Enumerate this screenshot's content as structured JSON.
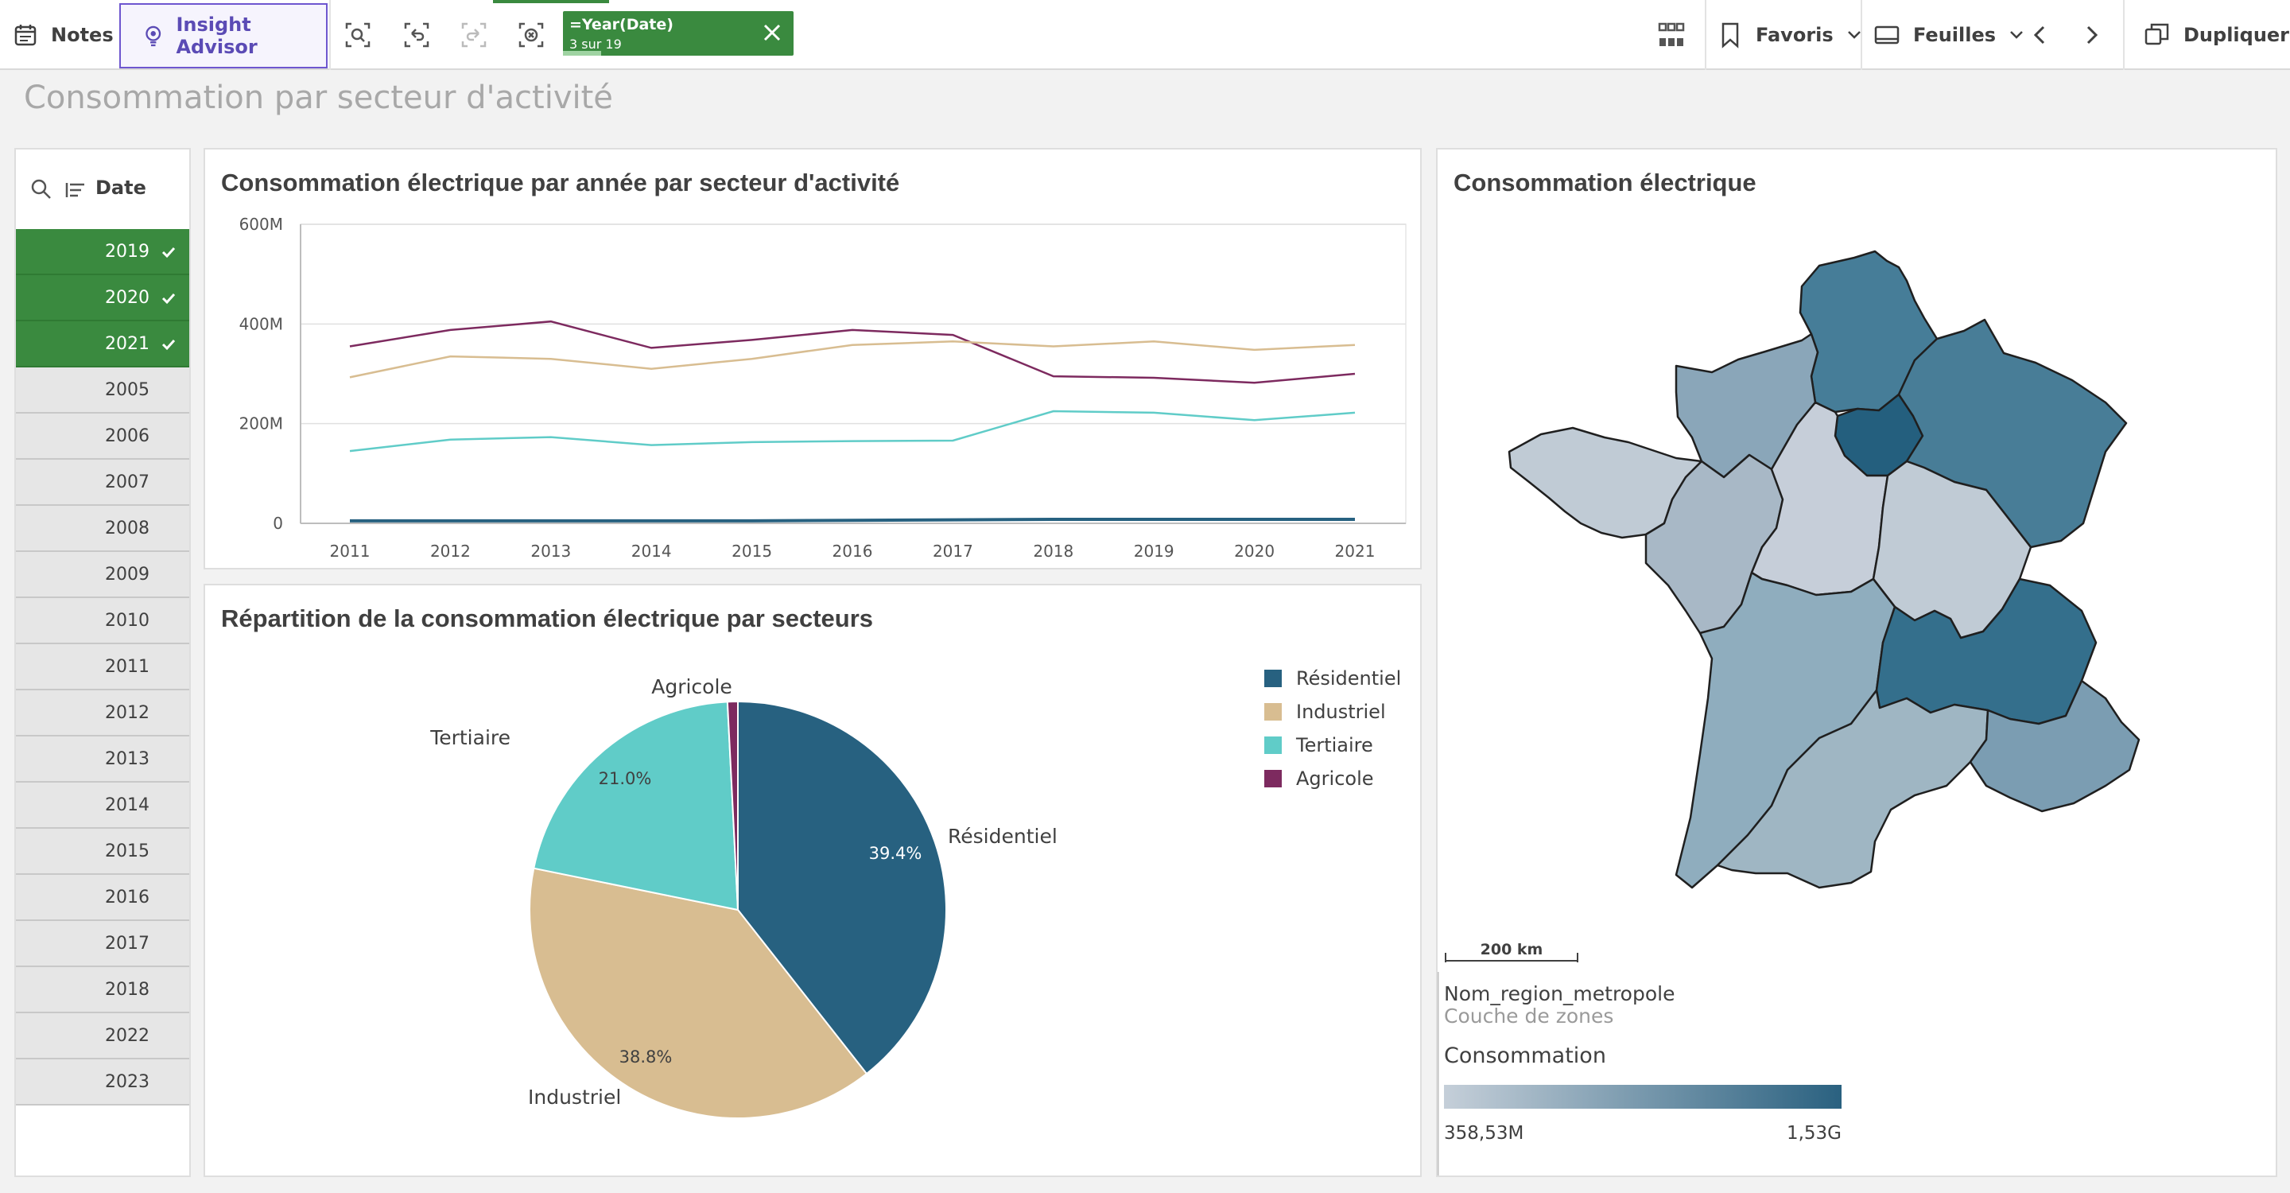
{
  "toolbar": {
    "notes_label": "Notes",
    "insight_label": "Insight Advisor",
    "selection": {
      "field": "=Year(Date)",
      "count": "3 sur 19"
    },
    "favoris_label": "Favoris",
    "feuilles_label": "Feuilles",
    "dupliquer_label": "Dupliquer"
  },
  "sheet_title": "Consommation par secteur d'activité",
  "filter": {
    "label": "Date",
    "items": [
      {
        "label": "2019",
        "selected": true
      },
      {
        "label": "2020",
        "selected": true
      },
      {
        "label": "2021",
        "selected": true
      },
      {
        "label": "2005",
        "selected": false
      },
      {
        "label": "2006",
        "selected": false
      },
      {
        "label": "2007",
        "selected": false
      },
      {
        "label": "2008",
        "selected": false
      },
      {
        "label": "2009",
        "selected": false
      },
      {
        "label": "2010",
        "selected": false
      },
      {
        "label": "2011",
        "selected": false
      },
      {
        "label": "2012",
        "selected": false
      },
      {
        "label": "2013",
        "selected": false
      },
      {
        "label": "2014",
        "selected": false
      },
      {
        "label": "2015",
        "selected": false
      },
      {
        "label": "2016",
        "selected": false
      },
      {
        "label": "2017",
        "selected": false
      },
      {
        "label": "2018",
        "selected": false
      },
      {
        "label": "2022",
        "selected": false
      },
      {
        "label": "2023",
        "selected": false
      }
    ]
  },
  "line_panel": {
    "title": "Consommation électrique par année par secteur d'activité"
  },
  "pie_panel": {
    "title": "Répartition de la consommation électrique par secteurs"
  },
  "map_panel": {
    "title": "Consommation électrique",
    "scale_label": "200 km",
    "layer_name": "Nom_region_metropole",
    "layer_type": "Couche de zones",
    "legend_title": "Consommation",
    "legend_min": "358,53M",
    "legend_max": "1,53G",
    "legend_colors": [
      "#c5cfd9",
      "#2a6180"
    ]
  },
  "colors": {
    "accent_green": "#3a8a3f",
    "residentiel": "#276180",
    "industriel": "#d8bd91",
    "tertiaire": "#60ccc8",
    "agricole": "#7d2a5f"
  },
  "chart_data": [
    {
      "type": "line",
      "x": [
        "2011",
        "2012",
        "2013",
        "2014",
        "2015",
        "2016",
        "2017",
        "2018",
        "2019",
        "2020",
        "2021"
      ],
      "yticks": [
        "0",
        "200M",
        "400M",
        "600M"
      ],
      "ylim": [
        0,
        600
      ],
      "series": [
        {
          "color": "#7d2a5f",
          "values": [
            355,
            388,
            405,
            352,
            368,
            388,
            378,
            295,
            292,
            282,
            300
          ]
        },
        {
          "color": "#d8bd91",
          "values": [
            293,
            335,
            330,
            310,
            330,
            358,
            365,
            355,
            365,
            348,
            358
          ]
        },
        {
          "color": "#60ccc8",
          "values": [
            145,
            168,
            173,
            157,
            163,
            165,
            166,
            225,
            222,
            207,
            222
          ]
        },
        {
          "color": "#276180",
          "values": [
            5,
            5,
            5,
            5,
            5,
            6,
            7,
            8,
            8,
            8,
            8
          ]
        }
      ]
    },
    {
      "type": "pie",
      "slices": [
        {
          "label": "Résidentiel",
          "value": 39.4,
          "pct": "39.4%",
          "color": "#276180"
        },
        {
          "label": "Industriel",
          "value": 38.8,
          "pct": "38.8%",
          "color": "#d8bd91"
        },
        {
          "label": "Tertiaire",
          "value": 21.0,
          "pct": "21.0%",
          "color": "#60ccc8"
        },
        {
          "label": "Agricole",
          "value": 0.8,
          "pct": "",
          "color": "#7d2a5f"
        }
      ],
      "legend": [
        "Résidentiel",
        "Industriel",
        "Tertiaire",
        "Agricole"
      ]
    }
  ]
}
